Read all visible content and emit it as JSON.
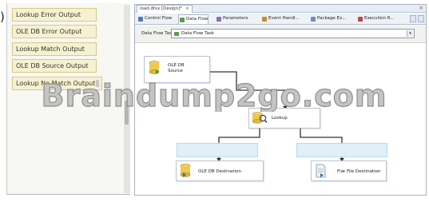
{
  "output_panel": {
    "items": [
      {
        "label": "Lookup Error Output"
      },
      {
        "label": "OLE DB Error Output"
      },
      {
        "label": "Lookup Match Output"
      },
      {
        "label": "OLE DB Source Output"
      },
      {
        "label": "Lookup No Match Output"
      }
    ]
  },
  "designer": {
    "doc_tab": {
      "label": "load.dtsx [Design]*",
      "close": "×"
    },
    "window_close": "×",
    "view_tabs": [
      {
        "label": "Control Flow",
        "icon": "control-flow-icon"
      },
      {
        "label": "Data Flow",
        "icon": "data-flow-icon",
        "active": true
      },
      {
        "label": "Parameters",
        "icon": "parameters-icon"
      },
      {
        "label": "Event Handl...",
        "icon": "event-handlers-icon"
      },
      {
        "label": "Package Ex...",
        "icon": "package-explorer-icon"
      },
      {
        "label": "Execution R...",
        "icon": "execution-results-icon"
      }
    ],
    "task_bar": {
      "label": "Data Flow Task:",
      "selected": "Data Flow Task",
      "dropdown_glyph": "▾"
    }
  },
  "nodes": {
    "source": {
      "line1": "OLE DB",
      "line2": "Source"
    },
    "lookup": {
      "label": "Lookup"
    },
    "ole_destination": {
      "label": "OLE DB Destination"
    },
    "flat_destination": {
      "label": "Flat File Destination"
    }
  },
  "watermark": {
    "text": "Braindump2go.com"
  },
  "edge": {
    "text": ")"
  },
  "colors": {
    "output_item_bg": "#f6f1cf",
    "path_label_bg": "#dff0f8",
    "watermark_fill": "#c4c4c4",
    "selection_blue": "#4b7ab7"
  }
}
